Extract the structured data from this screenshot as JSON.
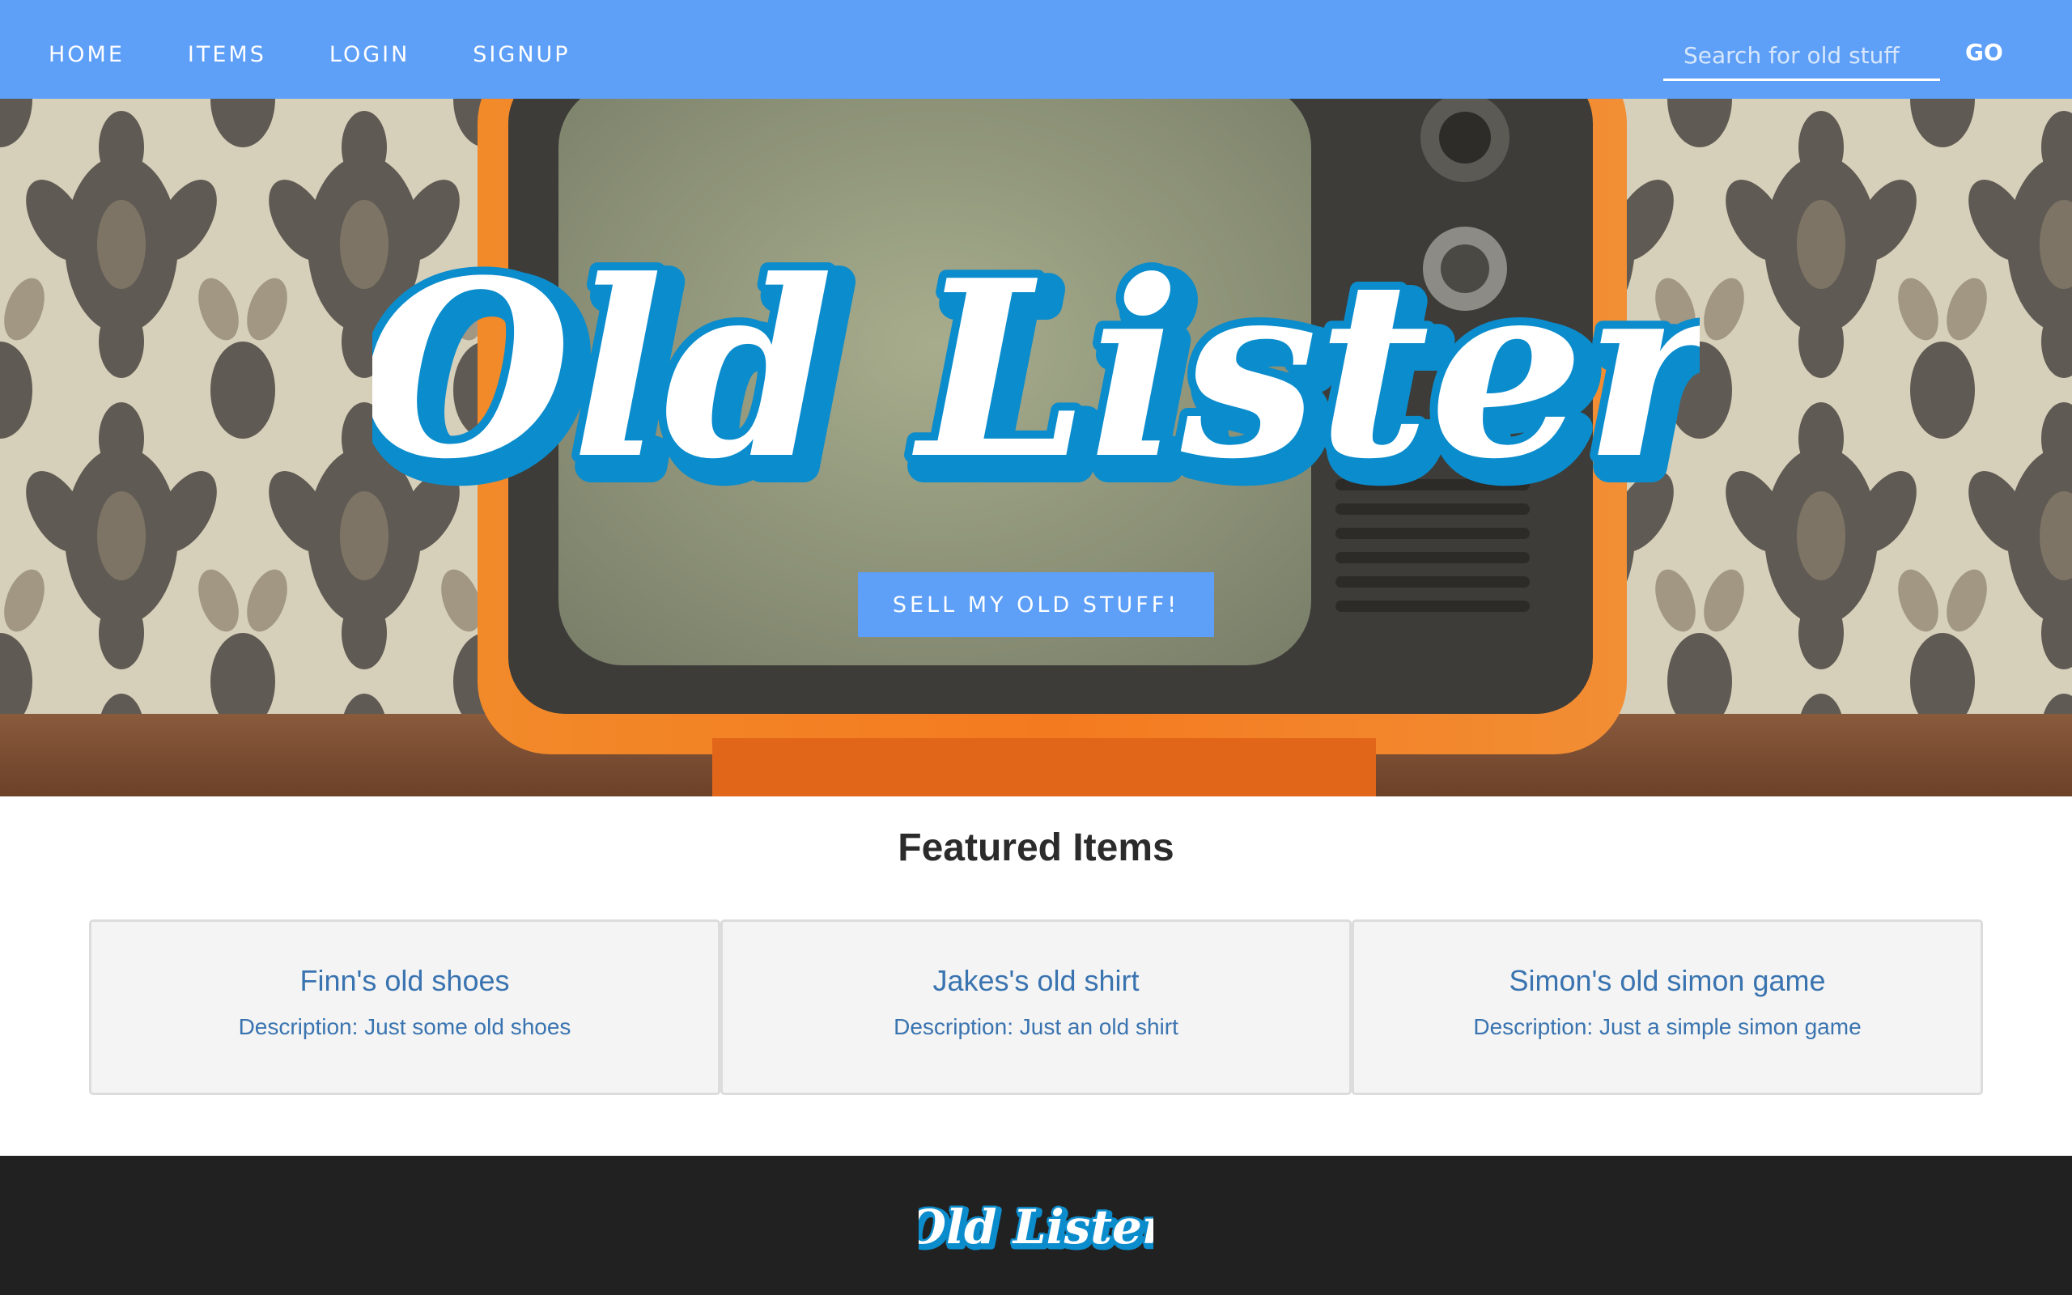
{
  "navbar": {
    "links": [
      {
        "label": "HOME"
      },
      {
        "label": "ITEMS"
      },
      {
        "label": "LOGIN"
      },
      {
        "label": "SIGNUP"
      }
    ],
    "search": {
      "placeholder": "Search for old stuff"
    },
    "go_label": "GO"
  },
  "hero": {
    "logo_text": "Old Lister",
    "sell_button_label": "SELL MY OLD STUFF!"
  },
  "featured": {
    "title": "Featured Items",
    "items": [
      {
        "title": "Finn's old shoes",
        "description": "Description: Just some old shoes"
      },
      {
        "title": "Jakes's old shirt",
        "description": "Description: Just an old shirt"
      },
      {
        "title": "Simon's old simon game",
        "description": "Description: Just a simple simon game"
      }
    ]
  },
  "footer": {
    "logo_text": "Old Lister"
  },
  "colors": {
    "navbar": "#5e9ff7",
    "accent_blue": "#0b8ccc",
    "card_text": "#3a74b0",
    "footer": "#212121",
    "tv_orange": "#f07a22"
  },
  "icons": [
    "retro-tv-image",
    "damask-wallpaper-image"
  ]
}
